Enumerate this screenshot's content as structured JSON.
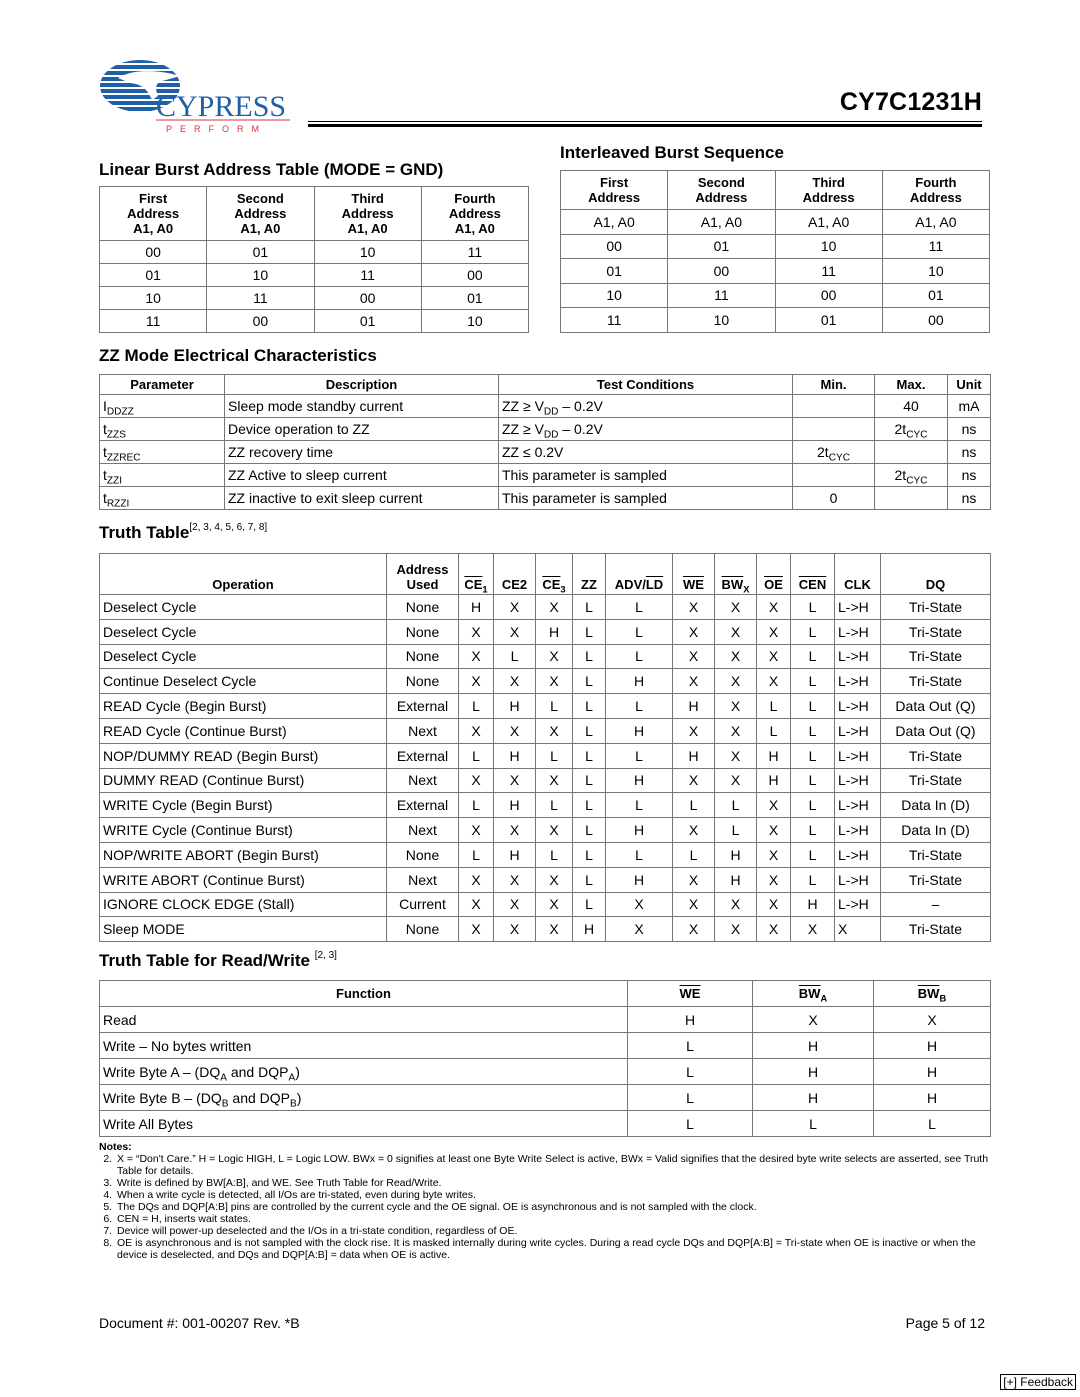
{
  "header": {
    "company": "CYPRESS",
    "tagline": "PERFORM",
    "part_number": "CY7C1231H",
    "colors": {
      "logo_blue": "#1f5fa8",
      "tagline_red": "#d8343a"
    }
  },
  "linear_burst": {
    "title": "Linear Burst Address Table (MODE = GND)",
    "headers": [
      [
        "First",
        "Address",
        "A1, A0"
      ],
      [
        "Second",
        "Address",
        "A1, A0"
      ],
      [
        "Third",
        "Address",
        "A1, A0"
      ],
      [
        "Fourth",
        "Address",
        "A1, A0"
      ]
    ],
    "rows": [
      [
        "00",
        "01",
        "10",
        "11"
      ],
      [
        "01",
        "10",
        "11",
        "00"
      ],
      [
        "10",
        "11",
        "00",
        "01"
      ],
      [
        "11",
        "00",
        "01",
        "10"
      ]
    ]
  },
  "interleaved_burst": {
    "title": "Interleaved Burst Sequence",
    "headers": [
      [
        "First",
        "Address"
      ],
      [
        "Second",
        "Address"
      ],
      [
        "Third",
        "Address"
      ],
      [
        "Fourth",
        "Address"
      ]
    ],
    "subheader": [
      "A1, A0",
      "A1, A0",
      "A1, A0",
      "A1, A0"
    ],
    "rows": [
      [
        "00",
        "01",
        "10",
        "11"
      ],
      [
        "01",
        "00",
        "11",
        "10"
      ],
      [
        "10",
        "11",
        "00",
        "01"
      ],
      [
        "11",
        "10",
        "01",
        "00"
      ]
    ]
  },
  "zz_mode": {
    "title": "ZZ Mode Electrical Characteristics",
    "headers": [
      "Parameter",
      "Description",
      "Test Conditions",
      "Min.",
      "Max.",
      "Unit"
    ],
    "rows": [
      {
        "param": "I",
        "param_sub": "DDZZ",
        "desc": "Sleep mode standby current",
        "cond_pre": "ZZ ≥ V",
        "cond_sub": "DD",
        "cond_post": " – 0.2V",
        "min": "",
        "min_sub": "",
        "max": "40",
        "max_sub": "",
        "unit": "mA"
      },
      {
        "param": "t",
        "param_sub": "ZZS",
        "desc": "Device operation to ZZ",
        "cond_pre": "ZZ ≥ V",
        "cond_sub": "DD",
        "cond_post": " – 0.2V",
        "min": "",
        "min_sub": "",
        "max": "2t",
        "max_sub": "CYC",
        "unit": "ns"
      },
      {
        "param": "t",
        "param_sub": "ZZREC",
        "desc": "ZZ recovery time",
        "cond_pre": "ZZ ≤ 0.2V",
        "cond_sub": "",
        "cond_post": "",
        "min": "2t",
        "min_sub": "CYC",
        "max": "",
        "max_sub": "",
        "unit": "ns"
      },
      {
        "param": "t",
        "param_sub": "ZZI",
        "desc": "ZZ Active to sleep current",
        "cond_pre": "This parameter is sampled",
        "cond_sub": "",
        "cond_post": "",
        "min": "",
        "min_sub": "",
        "max": "2t",
        "max_sub": "CYC",
        "unit": "ns"
      },
      {
        "param": "t",
        "param_sub": "RZZI",
        "desc": "ZZ inactive to exit sleep current",
        "cond_pre": "This parameter is sampled",
        "cond_sub": "",
        "cond_post": "",
        "min": "0",
        "min_sub": "",
        "max": "",
        "max_sub": "",
        "unit": "ns"
      }
    ]
  },
  "truth_table": {
    "title": "Truth Table",
    "refs": "[2, 3, 4, 5, 6, 7, 8]",
    "headers": {
      "operation": "Operation",
      "address_used_1": "Address",
      "address_used_2": "Used",
      "ce1": "CE",
      "ce1_sub": "1",
      "ce2": "CE2",
      "ce3": "CE",
      "ce3_sub": "3",
      "zz": "ZZ",
      "adv": "ADV/",
      "ld": "LD",
      "we": "WE",
      "bwx": "BW",
      "bwx_sub": "X",
      "oe": "OE",
      "cen": "CEN",
      "clk": "CLK",
      "dq": "DQ"
    },
    "rows": [
      [
        "Deselect Cycle",
        "None",
        "H",
        "X",
        "X",
        "L",
        "L",
        "X",
        "X",
        "X",
        "L",
        "L->H",
        "Tri-State"
      ],
      [
        "Deselect Cycle",
        "None",
        "X",
        "X",
        "H",
        "L",
        "L",
        "X",
        "X",
        "X",
        "L",
        "L->H",
        "Tri-State"
      ],
      [
        "Deselect Cycle",
        "None",
        "X",
        "L",
        "X",
        "L",
        "L",
        "X",
        "X",
        "X",
        "L",
        "L->H",
        "Tri-State"
      ],
      [
        "Continue Deselect Cycle",
        "None",
        "X",
        "X",
        "X",
        "L",
        "H",
        "X",
        "X",
        "X",
        "L",
        "L->H",
        "Tri-State"
      ],
      [
        "READ Cycle (Begin Burst)",
        "External",
        "L",
        "H",
        "L",
        "L",
        "L",
        "H",
        "X",
        "L",
        "L",
        "L->H",
        "Data Out (Q)"
      ],
      [
        "READ Cycle (Continue Burst)",
        "Next",
        "X",
        "X",
        "X",
        "L",
        "H",
        "X",
        "X",
        "L",
        "L",
        "L->H",
        "Data Out (Q)"
      ],
      [
        "NOP/DUMMY READ (Begin Burst)",
        "External",
        "L",
        "H",
        "L",
        "L",
        "L",
        "H",
        "X",
        "H",
        "L",
        "L->H",
        "Tri-State"
      ],
      [
        "DUMMY READ (Continue Burst)",
        "Next",
        "X",
        "X",
        "X",
        "L",
        "H",
        "X",
        "X",
        "H",
        "L",
        "L->H",
        "Tri-State"
      ],
      [
        "WRITE Cycle (Begin Burst)",
        "External",
        "L",
        "H",
        "L",
        "L",
        "L",
        "L",
        "L",
        "X",
        "L",
        "L->H",
        "Data In (D)"
      ],
      [
        "WRITE Cycle (Continue Burst)",
        "Next",
        "X",
        "X",
        "X",
        "L",
        "H",
        "X",
        "L",
        "X",
        "L",
        "L->H",
        "Data In (D)"
      ],
      [
        "NOP/WRITE ABORT (Begin Burst)",
        "None",
        "L",
        "H",
        "L",
        "L",
        "L",
        "L",
        "H",
        "X",
        "L",
        "L->H",
        "Tri-State"
      ],
      [
        "WRITE ABORT (Continue Burst)",
        "Next",
        "X",
        "X",
        "X",
        "L",
        "H",
        "X",
        "H",
        "X",
        "L",
        "L->H",
        "Tri-State"
      ],
      [
        "IGNORE CLOCK EDGE (Stall)",
        "Current",
        "X",
        "X",
        "X",
        "L",
        "X",
        "X",
        "X",
        "X",
        "H",
        "L->H",
        "–"
      ],
      [
        "Sleep MODE",
        "None",
        "X",
        "X",
        "X",
        "H",
        "X",
        "X",
        "X",
        "X",
        "X",
        "X",
        "Tri-State"
      ]
    ]
  },
  "rw_table": {
    "title": "Truth Table for Read/Write",
    "refs": "[2, 3]",
    "headers": {
      "function": "Function",
      "we": "WE",
      "bwa": "BW",
      "bwa_sub": "A",
      "bwb": "BW",
      "bwb_sub": "B"
    },
    "rows": [
      {
        "f_pre": "Read",
        "f_s1": "",
        "f_mid": "",
        "f_s2": "",
        "f_post": "",
        "we": "H",
        "bwa": "X",
        "bwb": "X"
      },
      {
        "f_pre": "Write – No bytes written",
        "f_s1": "",
        "f_mid": "",
        "f_s2": "",
        "f_post": "",
        "we": "L",
        "bwa": "H",
        "bwb": "H"
      },
      {
        "f_pre": "Write Byte A – (DQ",
        "f_s1": "A",
        "f_mid": " and DQP",
        "f_s2": "A",
        "f_post": ")",
        "we": "L",
        "bwa": "H",
        "bwb": "H"
      },
      {
        "f_pre": "Write Byte B – (DQ",
        "f_s1": "B",
        "f_mid": " and DQP",
        "f_s2": "B",
        "f_post": ")",
        "we": "L",
        "bwa": "H",
        "bwb": "H"
      },
      {
        "f_pre": "Write All Bytes",
        "f_s1": "",
        "f_mid": "",
        "f_s2": "",
        "f_post": "",
        "we": "L",
        "bwa": "L",
        "bwb": "L"
      }
    ]
  },
  "notes": {
    "title": "Notes:",
    "items": [
      "X = “Don't Care.” H = Logic HIGH, L = Logic LOW. BWx = 0 signifies at least one Byte Write Select is active, BWx = Valid signifies that the desired byte write selects are asserted, see Truth Table for details.",
      "Write is defined by BW[A:B], and WE. See Truth Table for Read/Write.",
      "When a write cycle is detected, all I/Os are tri-stated, even during byte writes.",
      "The DQs and DQP[A:B] pins are controlled by the current cycle and the OE signal. OE is asynchronous and is not sampled with the clock.",
      "CEN = H, inserts wait states.",
      "Device will power-up deselected and the I/Os in a tri-state condition, regardless of OE.",
      "OE is asynchronous and is not sampled with the clock rise. It is masked internally during write cycles. During a read cycle DQs and DQP[A:B] = Tri-state when OE is inactive or when the device is deselected, and DQs and DQP[A:B] = data when OE is active."
    ],
    "start_number": 2
  },
  "footer": {
    "document_number": "Document #: 001-00207 Rev. *B",
    "page": "Page 5 of 12",
    "feedback_label": "[+] Feedback"
  }
}
